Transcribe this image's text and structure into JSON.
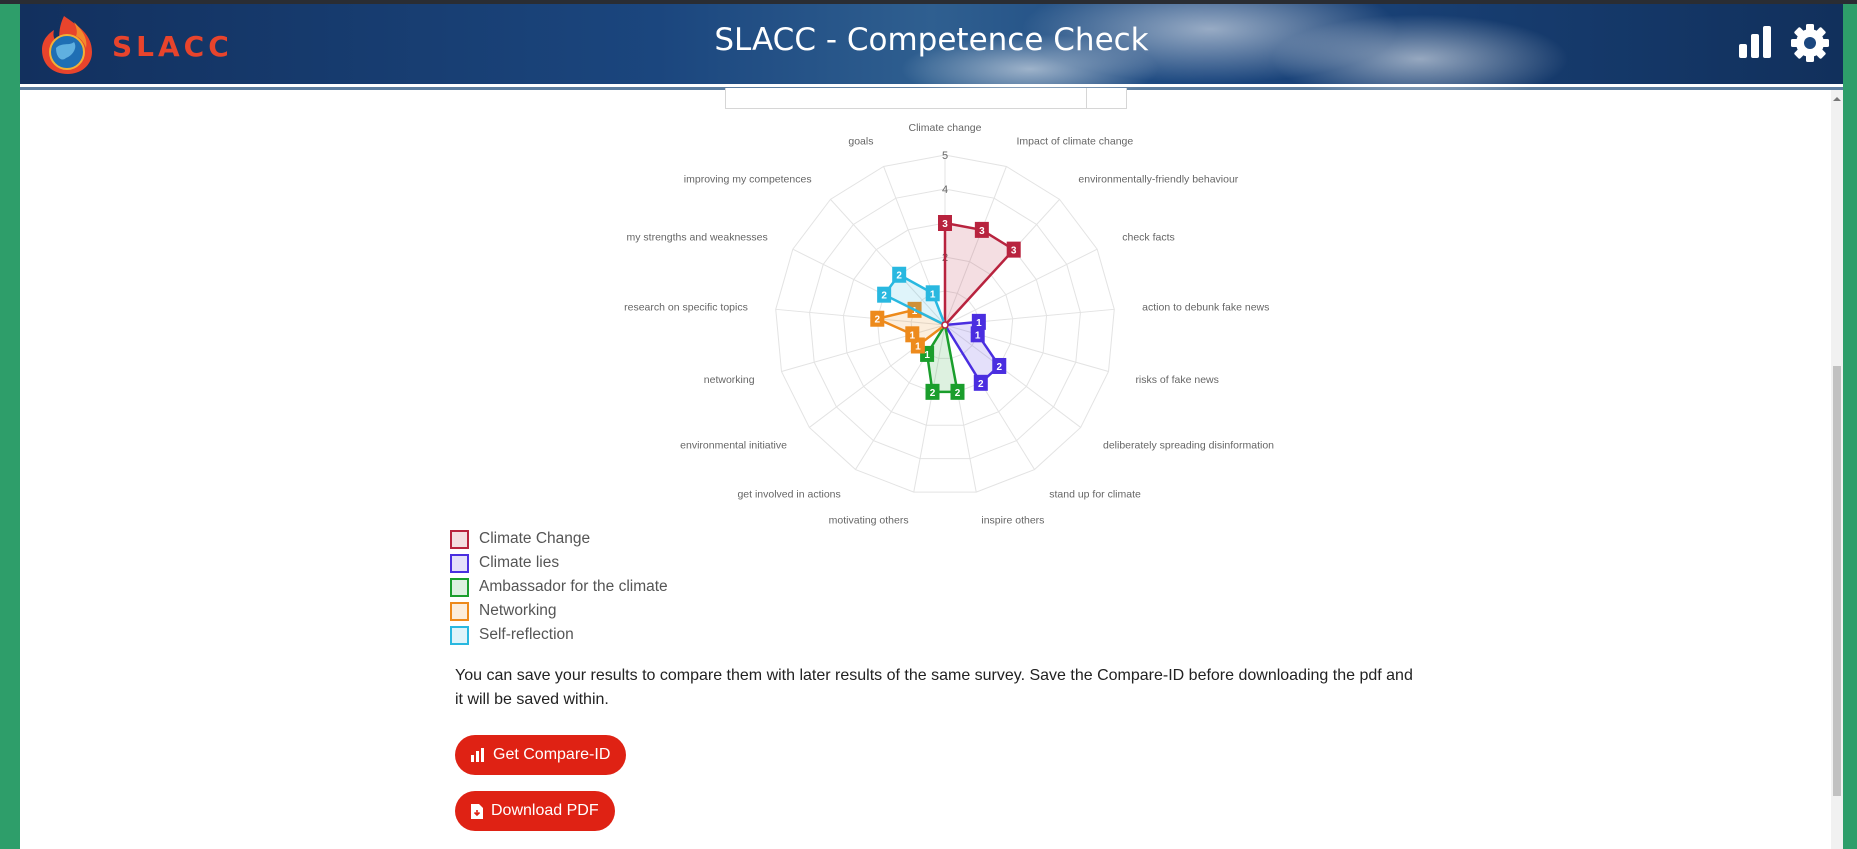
{
  "app": {
    "logo_text": "SLACC",
    "title": "SLACC - Competence Check",
    "icons": [
      "bar-chart-icon",
      "gear-icon"
    ]
  },
  "chart_data": {
    "type": "radar",
    "axes": [
      "Climate change",
      "Impact of climate change",
      "environmentally-friendly behaviour",
      "check facts",
      "action to debunk fake news",
      "risks of fake news",
      "deliberately spreading disinformation",
      "stand up for climate",
      "inspire others",
      "motivating others",
      "get involved in actions",
      "environmental initiative",
      "networking",
      "research on specific topics",
      "my strengths and weaknesses",
      "improving my competences",
      "goals"
    ],
    "range": [
      0,
      5
    ],
    "tick_labels": [
      "2",
      "4",
      "5"
    ],
    "grid": true,
    "series": [
      {
        "name": "Climate Change",
        "color": "#b8233e",
        "values": [
          3,
          3,
          3,
          0,
          0,
          0,
          0,
          0,
          0,
          0,
          0,
          0,
          0,
          0,
          0,
          0,
          0
        ]
      },
      {
        "name": "Climate lies",
        "color": "#4a2ee0",
        "values": [
          0,
          0,
          0,
          0,
          1,
          1,
          2,
          2,
          0,
          0,
          0,
          0,
          0,
          0,
          0,
          0,
          0
        ]
      },
      {
        "name": "Ambassador for the climate",
        "color": "#1a9e2c",
        "values": [
          0,
          0,
          0,
          0,
          0,
          0,
          0,
          0,
          2,
          2,
          1,
          0,
          0,
          0,
          0,
          0,
          0
        ]
      },
      {
        "name": "Networking",
        "color": "#ed8a1c",
        "values": [
          0,
          0,
          0,
          0,
          0,
          0,
          0,
          0,
          0,
          0,
          0,
          1,
          1,
          2,
          1,
          0,
          0
        ]
      },
      {
        "name": "Self-reflection",
        "color": "#29b8e0",
        "values": [
          0,
          0,
          0,
          0,
          0,
          0,
          0,
          0,
          0,
          0,
          0,
          0,
          0,
          0,
          2,
          2,
          1
        ]
      }
    ],
    "legend_position": "bottom-left"
  },
  "info_text": "You can save your results to compare them with later results of the same survey. Save the Compare-ID before downloading the pdf and it will be saved within.",
  "buttons": {
    "compare": {
      "label": "Get Compare-ID",
      "icon": "bar-chart-icon"
    },
    "pdf": {
      "label": "Download PDF",
      "icon": "pdf-file-icon"
    }
  }
}
